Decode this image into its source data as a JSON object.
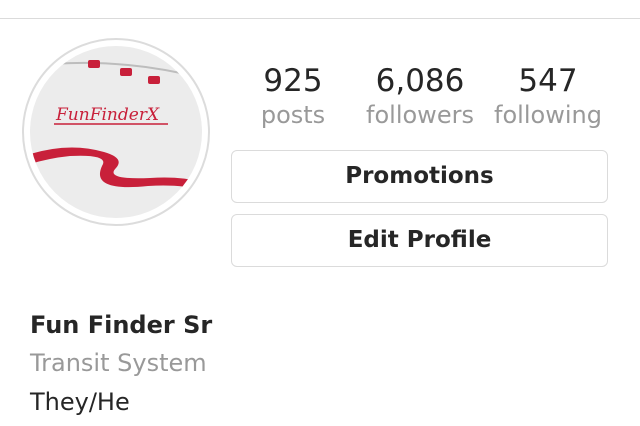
{
  "stats": {
    "posts": {
      "value": "925",
      "label": "posts"
    },
    "followers": {
      "value": "6,086",
      "label": "followers"
    },
    "following": {
      "value": "547",
      "label": "following"
    }
  },
  "buttons": {
    "promotions": "Promotions",
    "edit_profile": "Edit Profile"
  },
  "bio": {
    "name": "Fun Finder Sr",
    "category": "Transit System",
    "pronouns": "They/He"
  },
  "avatar": {
    "logo_text": "FunFinderX",
    "colors": {
      "logo_red": "#c8203a",
      "background": "#eeeeee"
    }
  }
}
